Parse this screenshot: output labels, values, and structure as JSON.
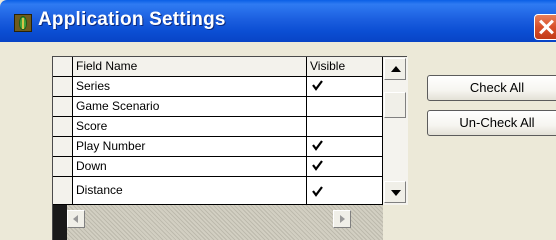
{
  "window": {
    "title": "Application Settings",
    "icon": "app-leaf-icon",
    "close_icon": "close-icon"
  },
  "grid": {
    "columns": [
      "Field Name",
      "Visible"
    ],
    "rows": [
      {
        "name": "Series",
        "visible": true
      },
      {
        "name": "Game Scenario",
        "visible": false
      },
      {
        "name": "Score",
        "visible": false
      },
      {
        "name": "Play Number",
        "visible": true
      },
      {
        "name": "Down",
        "visible": true
      },
      {
        "name": "Distance",
        "visible": true
      }
    ]
  },
  "buttons": {
    "check_all": "Check All",
    "uncheck_all": "Un-Check All"
  },
  "colors": {
    "titlebar": "#0B4ED3",
    "close_button": "#D8502A",
    "dialog_background": "#ECE9D8"
  }
}
